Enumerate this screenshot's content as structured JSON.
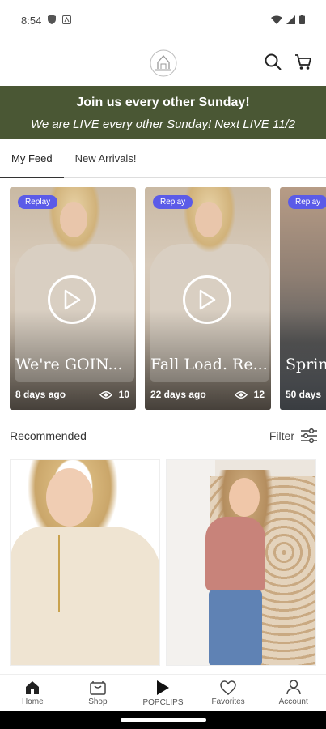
{
  "status_bar": {
    "time": "8:54"
  },
  "header": {
    "logo": "store-logo",
    "icons": [
      "search-icon",
      "cart-icon"
    ]
  },
  "banner": {
    "title": "Join us every other Sunday!",
    "subtitle": "We are LIVE every other Sunday! Next LIVE 11/2",
    "bg_color": "#4a5734"
  },
  "tabs": [
    {
      "label": "My Feed",
      "active": true
    },
    {
      "label": "New Arrivals!",
      "active": false
    }
  ],
  "live_cards": [
    {
      "badge": "Replay",
      "title": "We're GOIN...",
      "age": "8 days ago",
      "views": "10"
    },
    {
      "badge": "Replay",
      "title": "Fall Load. Re...",
      "age": "22 days ago",
      "views": "12"
    },
    {
      "badge": "Replay",
      "title": "Sprin",
      "age": "50 days",
      "views": ""
    }
  ],
  "recommended": {
    "title": "Recommended",
    "filter_label": "Filter"
  },
  "bottom_nav": [
    {
      "label": "Home",
      "icon": "home-icon",
      "active": true
    },
    {
      "label": "Shop",
      "icon": "shop-icon",
      "active": false
    },
    {
      "label": "POPCLIPS",
      "icon": "play-icon",
      "active": false
    },
    {
      "label": "Favorites",
      "icon": "heart-icon",
      "active": false
    },
    {
      "label": "Account",
      "icon": "account-icon",
      "active": false
    }
  ],
  "colors": {
    "accent": "#5b5be8",
    "banner": "#4a5734"
  }
}
